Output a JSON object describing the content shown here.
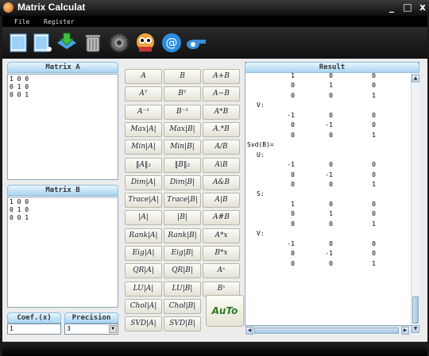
{
  "window": {
    "title": "Matrix Calculat",
    "min": "_",
    "max": "□",
    "close": "x"
  },
  "menu": [
    "File",
    "Register"
  ],
  "toolbar": [
    "new-icon",
    "open-icon",
    "download-icon",
    "trash-icon",
    "gear-icon",
    "mascot-icon",
    "email-icon",
    "whistle-icon"
  ],
  "matrix_a": {
    "title": "Matrix A",
    "value": "1 0 0\n0 1 0\n0 0 1"
  },
  "matrix_b": {
    "title": "Matrix B",
    "value": "1 0 0\n0 1 0\n0 0 1"
  },
  "coef": {
    "label": "Coef.(x)",
    "value": "1"
  },
  "precision": {
    "label": "Precision",
    "value": "3"
  },
  "buttons": [
    [
      "A",
      "B",
      "A+B"
    ],
    [
      "Aᵀ",
      "Bᵀ",
      "A−B"
    ],
    [
      "A⁻¹",
      "B⁻¹",
      "A*B"
    ],
    [
      "Max|A|",
      "Max|B|",
      "A.*B"
    ],
    [
      "Min|A|",
      "Min|B|",
      "A/B"
    ],
    [
      "‖A‖₂",
      "‖B‖₂",
      "A\\B"
    ],
    [
      "Dim|A|",
      "Dim|B|",
      "A&B"
    ],
    [
      "Trace|A|",
      "Trace|B|",
      "A|B"
    ],
    [
      "|A|",
      "|B|",
      "A#B"
    ],
    [
      "Rank|A|",
      "Rank|B|",
      "A*x"
    ],
    [
      "Eig|A|",
      "Eig|B|",
      "B*x"
    ],
    [
      "QR|A|",
      "QR|B|",
      "Aˣ"
    ],
    [
      "LU|A|",
      "LU|B|",
      "Bˣ"
    ],
    [
      "Chol|A|",
      "Chol|B|"
    ],
    [
      "SVD|A|",
      "SVD|B|"
    ]
  ],
  "auto_label": "AuTo",
  "result": {
    "title": "Result",
    "lines": [
      {
        "cols": [
          "1",
          "0",
          "0"
        ]
      },
      {
        "cols": [
          "0",
          "1",
          "0"
        ]
      },
      {
        "cols": [
          "0",
          "0",
          "1"
        ]
      },
      {
        "text": "V:",
        "indent": 14
      },
      {
        "cols": [
          "-1",
          "0",
          "0"
        ]
      },
      {
        "cols": [
          "0",
          "-1",
          "0"
        ]
      },
      {
        "cols": [
          "0",
          "0",
          "1"
        ]
      },
      {
        "text": "Svd(B)=",
        "indent": 2
      },
      {
        "text": "U:",
        "indent": 14
      },
      {
        "cols": [
          "-1",
          "0",
          "0"
        ]
      },
      {
        "cols": [
          "0",
          "-1",
          "0"
        ]
      },
      {
        "cols": [
          "0",
          "0",
          "1"
        ]
      },
      {
        "text": "S:",
        "indent": 14
      },
      {
        "cols": [
          "1",
          "0",
          "0"
        ]
      },
      {
        "cols": [
          "0",
          "1",
          "0"
        ]
      },
      {
        "cols": [
          "0",
          "0",
          "1"
        ]
      },
      {
        "text": "V:",
        "indent": 14
      },
      {
        "cols": [
          "-1",
          "0",
          "0"
        ]
      },
      {
        "cols": [
          "0",
          "-1",
          "0"
        ]
      },
      {
        "cols": [
          "0",
          "0",
          "1"
        ]
      }
    ]
  }
}
